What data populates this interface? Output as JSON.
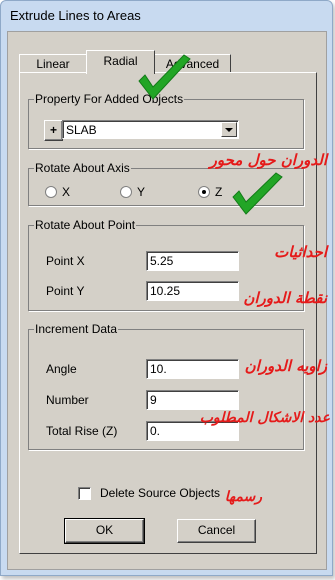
{
  "window": {
    "title": "Extrude Lines to Areas"
  },
  "tabs": [
    {
      "label": "Linear"
    },
    {
      "label": "Radial"
    },
    {
      "label": "Advanced"
    }
  ],
  "property_group": {
    "legend": "Property For Added Objects",
    "plus_label": "+",
    "selected": "SLAB"
  },
  "axis_group": {
    "legend": "Rotate About Axis",
    "options": [
      "X",
      "Y",
      "Z"
    ],
    "selected": "Z"
  },
  "point_group": {
    "legend": "Rotate About Point",
    "point_x": {
      "label": "Point X",
      "value": "5.25"
    },
    "point_y": {
      "label": "Point Y",
      "value": "10.25"
    }
  },
  "increment_group": {
    "legend": "Increment Data",
    "angle": {
      "label": "Angle",
      "value": "10."
    },
    "number": {
      "label": "Number",
      "value": "9"
    },
    "total_rise": {
      "label": "Total Rise (Z)",
      "value": "0."
    }
  },
  "delete_source": {
    "label": "Delete Source Objects",
    "checked": false
  },
  "buttons": {
    "ok": "OK",
    "cancel": "Cancel"
  },
  "annotations": {
    "axis_note": "الدوران حول محور",
    "coords_note": "احداثيات",
    "center_note": "نقطة الدوران",
    "angle_note": "زاويه الدوران",
    "count_note_1": "عدد الاشكال المطلوب",
    "count_note_2": "رسمها"
  },
  "colors": {
    "annotation": "#e51a1a",
    "checkmark": "#22a526",
    "dialog_face": "#d4d0c8",
    "title_bar": "#c8daf0"
  }
}
